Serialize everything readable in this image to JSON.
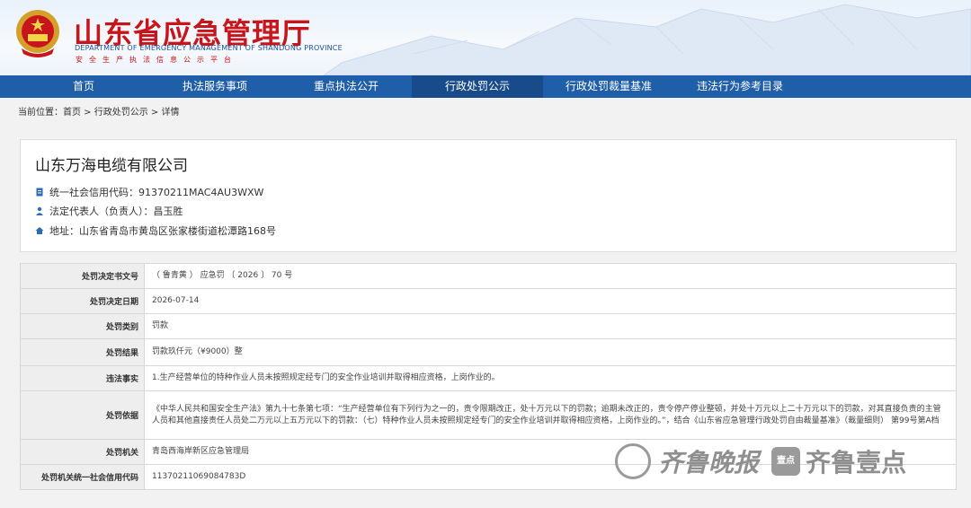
{
  "header": {
    "title": "山东省应急管理厅",
    "subtitle_en": "DEPARTMENT OF EMERGENCY MANAGEMENT OF SHANDONG PROVINCE",
    "slogan": "安全生产执法信息公示平台",
    "brand_color": "#c8141b"
  },
  "nav": {
    "items": [
      {
        "label": "首页"
      },
      {
        "label": "执法服务事项"
      },
      {
        "label": "重点执法公开"
      },
      {
        "label": "行政处罚公示",
        "active": true
      },
      {
        "label": "行政处罚裁量基准"
      },
      {
        "label": "违法行为参考目录"
      }
    ],
    "color": "#1f5ea8"
  },
  "breadcrumb": {
    "prefix": "当前位置：",
    "home": "首页",
    "sep1": " > ",
    "section": "行政处罚公示",
    "sep2": " > ",
    "current": "详情"
  },
  "company": {
    "name": "山东万海电缆有限公司",
    "credit_code": "统一社会信用代码：91370211MAC4AU3WXW",
    "legal_rep": "法定代表人（负责人）：昌玉胜",
    "address": "地址：山东省青岛市黄岛区张家楼街道松潭路168号"
  },
  "table": {
    "rows": [
      {
        "key": "处罚决定书文号",
        "value": "（ 鲁青黄 ） 应急罚 〔 2026 〕 70 号"
      },
      {
        "key": "处罚决定日期",
        "value": "2026-07-14"
      },
      {
        "key": "处罚类别",
        "value": "罚款"
      },
      {
        "key": "处罚结果",
        "value": "罚款玖仟元（¥9000）整"
      },
      {
        "key": "违法事实",
        "value": "1.生产经营单位的特种作业人员未按照规定经专门的安全作业培训并取得相应资格，上岗作业的。"
      },
      {
        "key": "处罚依据",
        "value": "《中华人民共和国安全生产法》第九十七条第七项：“生产经营单位有下列行为之一的，责令限期改正，处十万元以下的罚款；逾期未改正的，责令停产停业整顿，并处十万元以上二十万元以下的罚款，对其直接负责的主管人员和其他直接责任人员处二万元以上五万元以下的罚款：（七）特种作业人员未按照规定经专门的安全作业培训并取得相应资格，上岗作业的。”，结合《山东省应急管理行政处罚自由裁量基准》（裁量细则） 第99号第A档"
      },
      {
        "key": "处罚机关",
        "value": "青岛西海岸新区应急管理局"
      },
      {
        "key": "处罚机关统一社会信用代码",
        "value": "11370211069084783D"
      }
    ]
  },
  "watermark": {
    "left_text": "齐鲁晚报",
    "box_text": "壹点",
    "right_text": "齐鲁壹点"
  }
}
